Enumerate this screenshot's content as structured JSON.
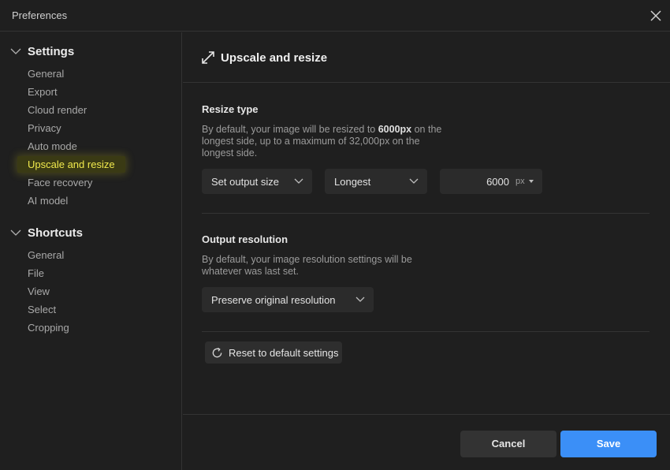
{
  "window": {
    "title": "Preferences"
  },
  "sidebar": {
    "groups": [
      {
        "label": "Settings",
        "items": [
          {
            "label": "General"
          },
          {
            "label": "Export"
          },
          {
            "label": "Cloud render"
          },
          {
            "label": "Privacy"
          },
          {
            "label": "Auto mode"
          },
          {
            "label": "Upscale and resize",
            "active": true
          },
          {
            "label": "Face recovery"
          },
          {
            "label": "AI model"
          }
        ]
      },
      {
        "label": "Shortcuts",
        "items": [
          {
            "label": "General"
          },
          {
            "label": "File"
          },
          {
            "label": "View"
          },
          {
            "label": "Select"
          },
          {
            "label": "Cropping"
          }
        ]
      }
    ]
  },
  "main": {
    "title": "Upscale and resize",
    "title_icon": "expand-arrows-icon",
    "resize": {
      "title": "Resize type",
      "desc_before": "By default, your image will be resized to ",
      "desc_bold": "6000px",
      "desc_after": " on the longest side, up to a maximum of 32,000px on the longest side.",
      "mode_value": "Set output size",
      "side_value": "Longest",
      "size_value": "6000",
      "unit": "px"
    },
    "resolution": {
      "title": "Output resolution",
      "desc": "By default, your image resolution settings will be whatever was last set.",
      "value": "Preserve original resolution"
    },
    "reset_label": "Reset to default settings"
  },
  "footer": {
    "cancel": "Cancel",
    "save": "Save"
  },
  "colors": {
    "accent": "#3b8ff7",
    "highlight": "#f0e94c",
    "background": "#1f1f1f"
  }
}
